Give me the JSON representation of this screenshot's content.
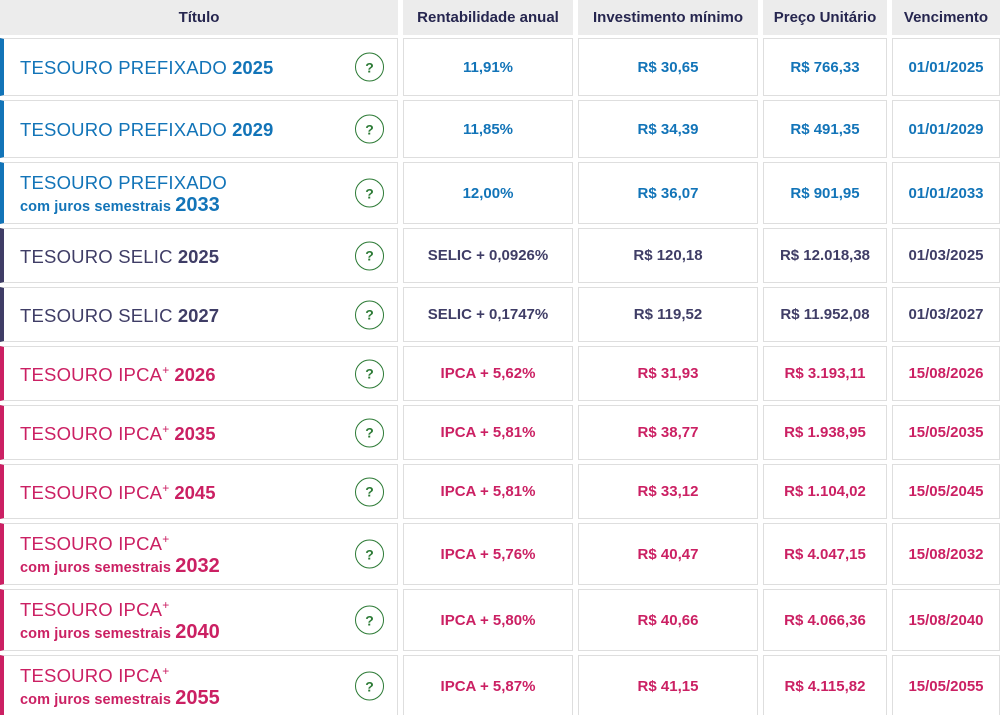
{
  "table": {
    "headers": {
      "titulo": "Título",
      "rentabilidade": "Rentabilidade anual",
      "investimento": "Investimento mínimo",
      "preco": "Preço Unitário",
      "vencimento": "Vencimento"
    },
    "help_label": "?",
    "colors": {
      "prefixado": "#1274b8",
      "selic": "#3f3d66",
      "ipca": "#cb2063",
      "help_green": "#2c7a35"
    },
    "rows": [
      {
        "theme": "prefixado",
        "name": "TESOURO PREFIXADO",
        "sup": "",
        "sub": "",
        "year": "2025",
        "rate": "11,91%",
        "min_investment": "R$ 30,65",
        "unit_price": "R$ 766,33",
        "maturity": "01/01/2025"
      },
      {
        "theme": "prefixado",
        "name": "TESOURO PREFIXADO",
        "sup": "",
        "sub": "",
        "year": "2029",
        "rate": "11,85%",
        "min_investment": "R$ 34,39",
        "unit_price": "R$ 491,35",
        "maturity": "01/01/2029"
      },
      {
        "theme": "prefixado",
        "name": "TESOURO PREFIXADO",
        "sup": "",
        "sub": "com juros semestrais",
        "year": "2033",
        "rate": "12,00%",
        "min_investment": "R$ 36,07",
        "unit_price": "R$ 901,95",
        "maturity": "01/01/2033"
      },
      {
        "theme": "selic",
        "name": "TESOURO SELIC",
        "sup": "",
        "sub": "",
        "year": "2025",
        "rate": "SELIC + 0,0926%",
        "min_investment": "R$ 120,18",
        "unit_price": "R$ 12.018,38",
        "maturity": "01/03/2025"
      },
      {
        "theme": "selic",
        "name": "TESOURO SELIC",
        "sup": "",
        "sub": "",
        "year": "2027",
        "rate": "SELIC + 0,1747%",
        "min_investment": "R$ 119,52",
        "unit_price": "R$ 11.952,08",
        "maturity": "01/03/2027"
      },
      {
        "theme": "ipca",
        "name": "TESOURO IPCA",
        "sup": "+",
        "sub": "",
        "year": "2026",
        "rate": "IPCA + 5,62%",
        "min_investment": "R$ 31,93",
        "unit_price": "R$ 3.193,11",
        "maturity": "15/08/2026"
      },
      {
        "theme": "ipca",
        "name": "TESOURO IPCA",
        "sup": "+",
        "sub": "",
        "year": "2035",
        "rate": "IPCA + 5,81%",
        "min_investment": "R$ 38,77",
        "unit_price": "R$ 1.938,95",
        "maturity": "15/05/2035"
      },
      {
        "theme": "ipca",
        "name": "TESOURO IPCA",
        "sup": "+",
        "sub": "",
        "year": "2045",
        "rate": "IPCA + 5,81%",
        "min_investment": "R$ 33,12",
        "unit_price": "R$ 1.104,02",
        "maturity": "15/05/2045"
      },
      {
        "theme": "ipca",
        "name": "TESOURO IPCA",
        "sup": "+",
        "sub": "com juros semestrais",
        "year": "2032",
        "rate": "IPCA + 5,76%",
        "min_investment": "R$ 40,47",
        "unit_price": "R$ 4.047,15",
        "maturity": "15/08/2032"
      },
      {
        "theme": "ipca",
        "name": "TESOURO IPCA",
        "sup": "+",
        "sub": "com juros semestrais",
        "year": "2040",
        "rate": "IPCA + 5,80%",
        "min_investment": "R$ 40,66",
        "unit_price": "R$ 4.066,36",
        "maturity": "15/08/2040"
      },
      {
        "theme": "ipca",
        "name": "TESOURO IPCA",
        "sup": "+",
        "sub": "com juros semestrais",
        "year": "2055",
        "rate": "IPCA + 5,87%",
        "min_investment": "R$ 41,15",
        "unit_price": "R$ 4.115,82",
        "maturity": "15/05/2055"
      }
    ]
  }
}
